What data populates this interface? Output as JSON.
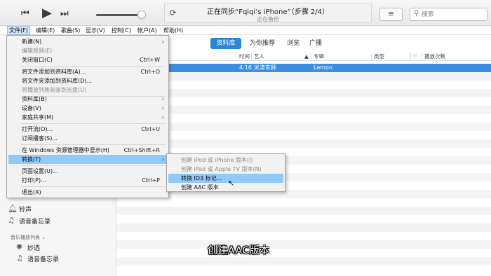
{
  "player": {
    "prev_icon": "⏮",
    "play_icon": "▶",
    "next_icon": "⏭",
    "volume_level": 0.9,
    "sync_title": "正在同步“Fqiqi’s iPhone”（步骤 2/4）",
    "sync_subtitle": "正在备份",
    "list_icon": "≡",
    "search_placeholder": "搜索"
  },
  "menubar": {
    "items": [
      "文件(F)",
      "编辑(E)",
      "歌曲(S)",
      "显示(V)",
      "控制(C)",
      "帐户(A)",
      "帮助(H)"
    ]
  },
  "file_menu": {
    "items": [
      {
        "label": "新建(N)",
        "submenu": true
      },
      {
        "label": "编辑规则(E)",
        "disabled": true
      },
      {
        "label": "关闭窗口(C)",
        "shortcut": "Ctrl+W"
      },
      {
        "label": "将文件添加到资料库(A)...",
        "shortcut": "Ctrl+O"
      },
      {
        "label": "将文件夹添加到资料库(D)..."
      },
      {
        "label": "将播放列表刻录到光盘(U)",
        "disabled": true
      },
      {
        "label": "资料库(B)",
        "submenu": true
      },
      {
        "label": "设备(V)",
        "submenu": true
      },
      {
        "label": "家庭共享(M)",
        "submenu": true
      },
      {
        "label": "打开流(O)...",
        "shortcut": "Ctrl+U"
      },
      {
        "label": "订阅播客(S)..."
      },
      {
        "label": "在 Windows 资源管理器中显示(H)",
        "shortcut": "Ctrl+Shift+R"
      },
      {
        "label": "转换(T)",
        "submenu": true,
        "highlighted": true
      },
      {
        "label": "页面设置(U)..."
      },
      {
        "label": "打印(P)...",
        "shortcut": "Ctrl+P"
      },
      {
        "label": "退出(X)"
      }
    ]
  },
  "convert_submenu": {
    "items": [
      {
        "label": "创建 iPod 或 iPhone 版本(I)",
        "disabled": true
      },
      {
        "label": "创建 iPad 或 Apple TV 版本(N)",
        "disabled": true
      },
      {
        "label": "转换 ID3 标记...",
        "highlighted": true
      },
      {
        "label": "创建 AAC 版本"
      }
    ]
  },
  "sidebar": {
    "items": [
      {
        "label": "铃声",
        "icon": "bell-icon"
      },
      {
        "label": "语音备忘录",
        "icon": "music-note-icon"
      }
    ],
    "playlists_heading": "音乐播放列表 ⌄",
    "playlists": [
      {
        "label": "妙选",
        "icon": "genius-icon"
      },
      {
        "label": "语音备忘录",
        "icon": "music-note-icon"
      }
    ]
  },
  "library": {
    "tabs": [
      "资料库",
      "为你推荐",
      "浏览",
      "广播"
    ],
    "selected_tab": "资料库",
    "columns": {
      "time": "时间",
      "artist": "艺人",
      "sort": "▲",
      "album": "专辑",
      "genre": "类型",
      "heart": "♡",
      "plays": "播放次数"
    },
    "rows": [
      {
        "time": "4:16",
        "artist": "米津玄師",
        "album": "Lemon",
        "selected": true
      }
    ]
  },
  "caption": "创建AAC版本",
  "colors": {
    "accent": "#2b86d9",
    "selection": "#3d8ee0",
    "menu_highlight": "#91c9f7"
  }
}
